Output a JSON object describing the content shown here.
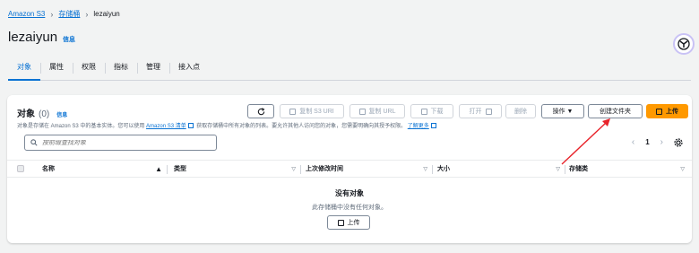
{
  "breadcrumb": {
    "items": [
      "Amazon S3",
      "存储桶",
      "lezaiyun"
    ]
  },
  "header": {
    "title": "lezaiyun",
    "info_label": "信息"
  },
  "tabs": [
    {
      "label": "对象",
      "active": true
    },
    {
      "label": "属性"
    },
    {
      "label": "权限"
    },
    {
      "label": "指标"
    },
    {
      "label": "管理"
    },
    {
      "label": "接入点"
    }
  ],
  "objects_panel": {
    "title": "对象",
    "count": "(0)",
    "info_label": "信息",
    "description": {
      "part1": "对象是存储在 Amazon S3 中的基本实体。您可以使用",
      "link1": "Amazon S3 清单",
      "part2": "获取存储桶中所有对象的列表。要允许其他人访问您的对象，您需要明确向其授予权限。",
      "link2": "了解更多"
    },
    "toolbar": {
      "refresh_label": "",
      "copy_s3_uri_label": "复制 S3 URI",
      "copy_url_label": "复制 URL",
      "download_label": "下载",
      "open_label": "打开",
      "delete_label": "删除",
      "actions_label": "操作 ▼",
      "create_folder_label": "创建文件夹",
      "upload_label": "上传"
    },
    "search": {
      "placeholder": "按前缀查找对象"
    },
    "pagination": {
      "current_page": "1"
    },
    "table": {
      "columns": [
        "名称",
        "类型",
        "上次修改时间",
        "大小",
        "存储类"
      ]
    },
    "empty_state": {
      "title": "没有对象",
      "subtitle": "此存储桶中没有任何对象。",
      "upload_label": "上传"
    }
  },
  "colors": {
    "accent": "#0972d3",
    "primary_button": "#ff9900",
    "annotation_arrow": "#e8232a"
  }
}
